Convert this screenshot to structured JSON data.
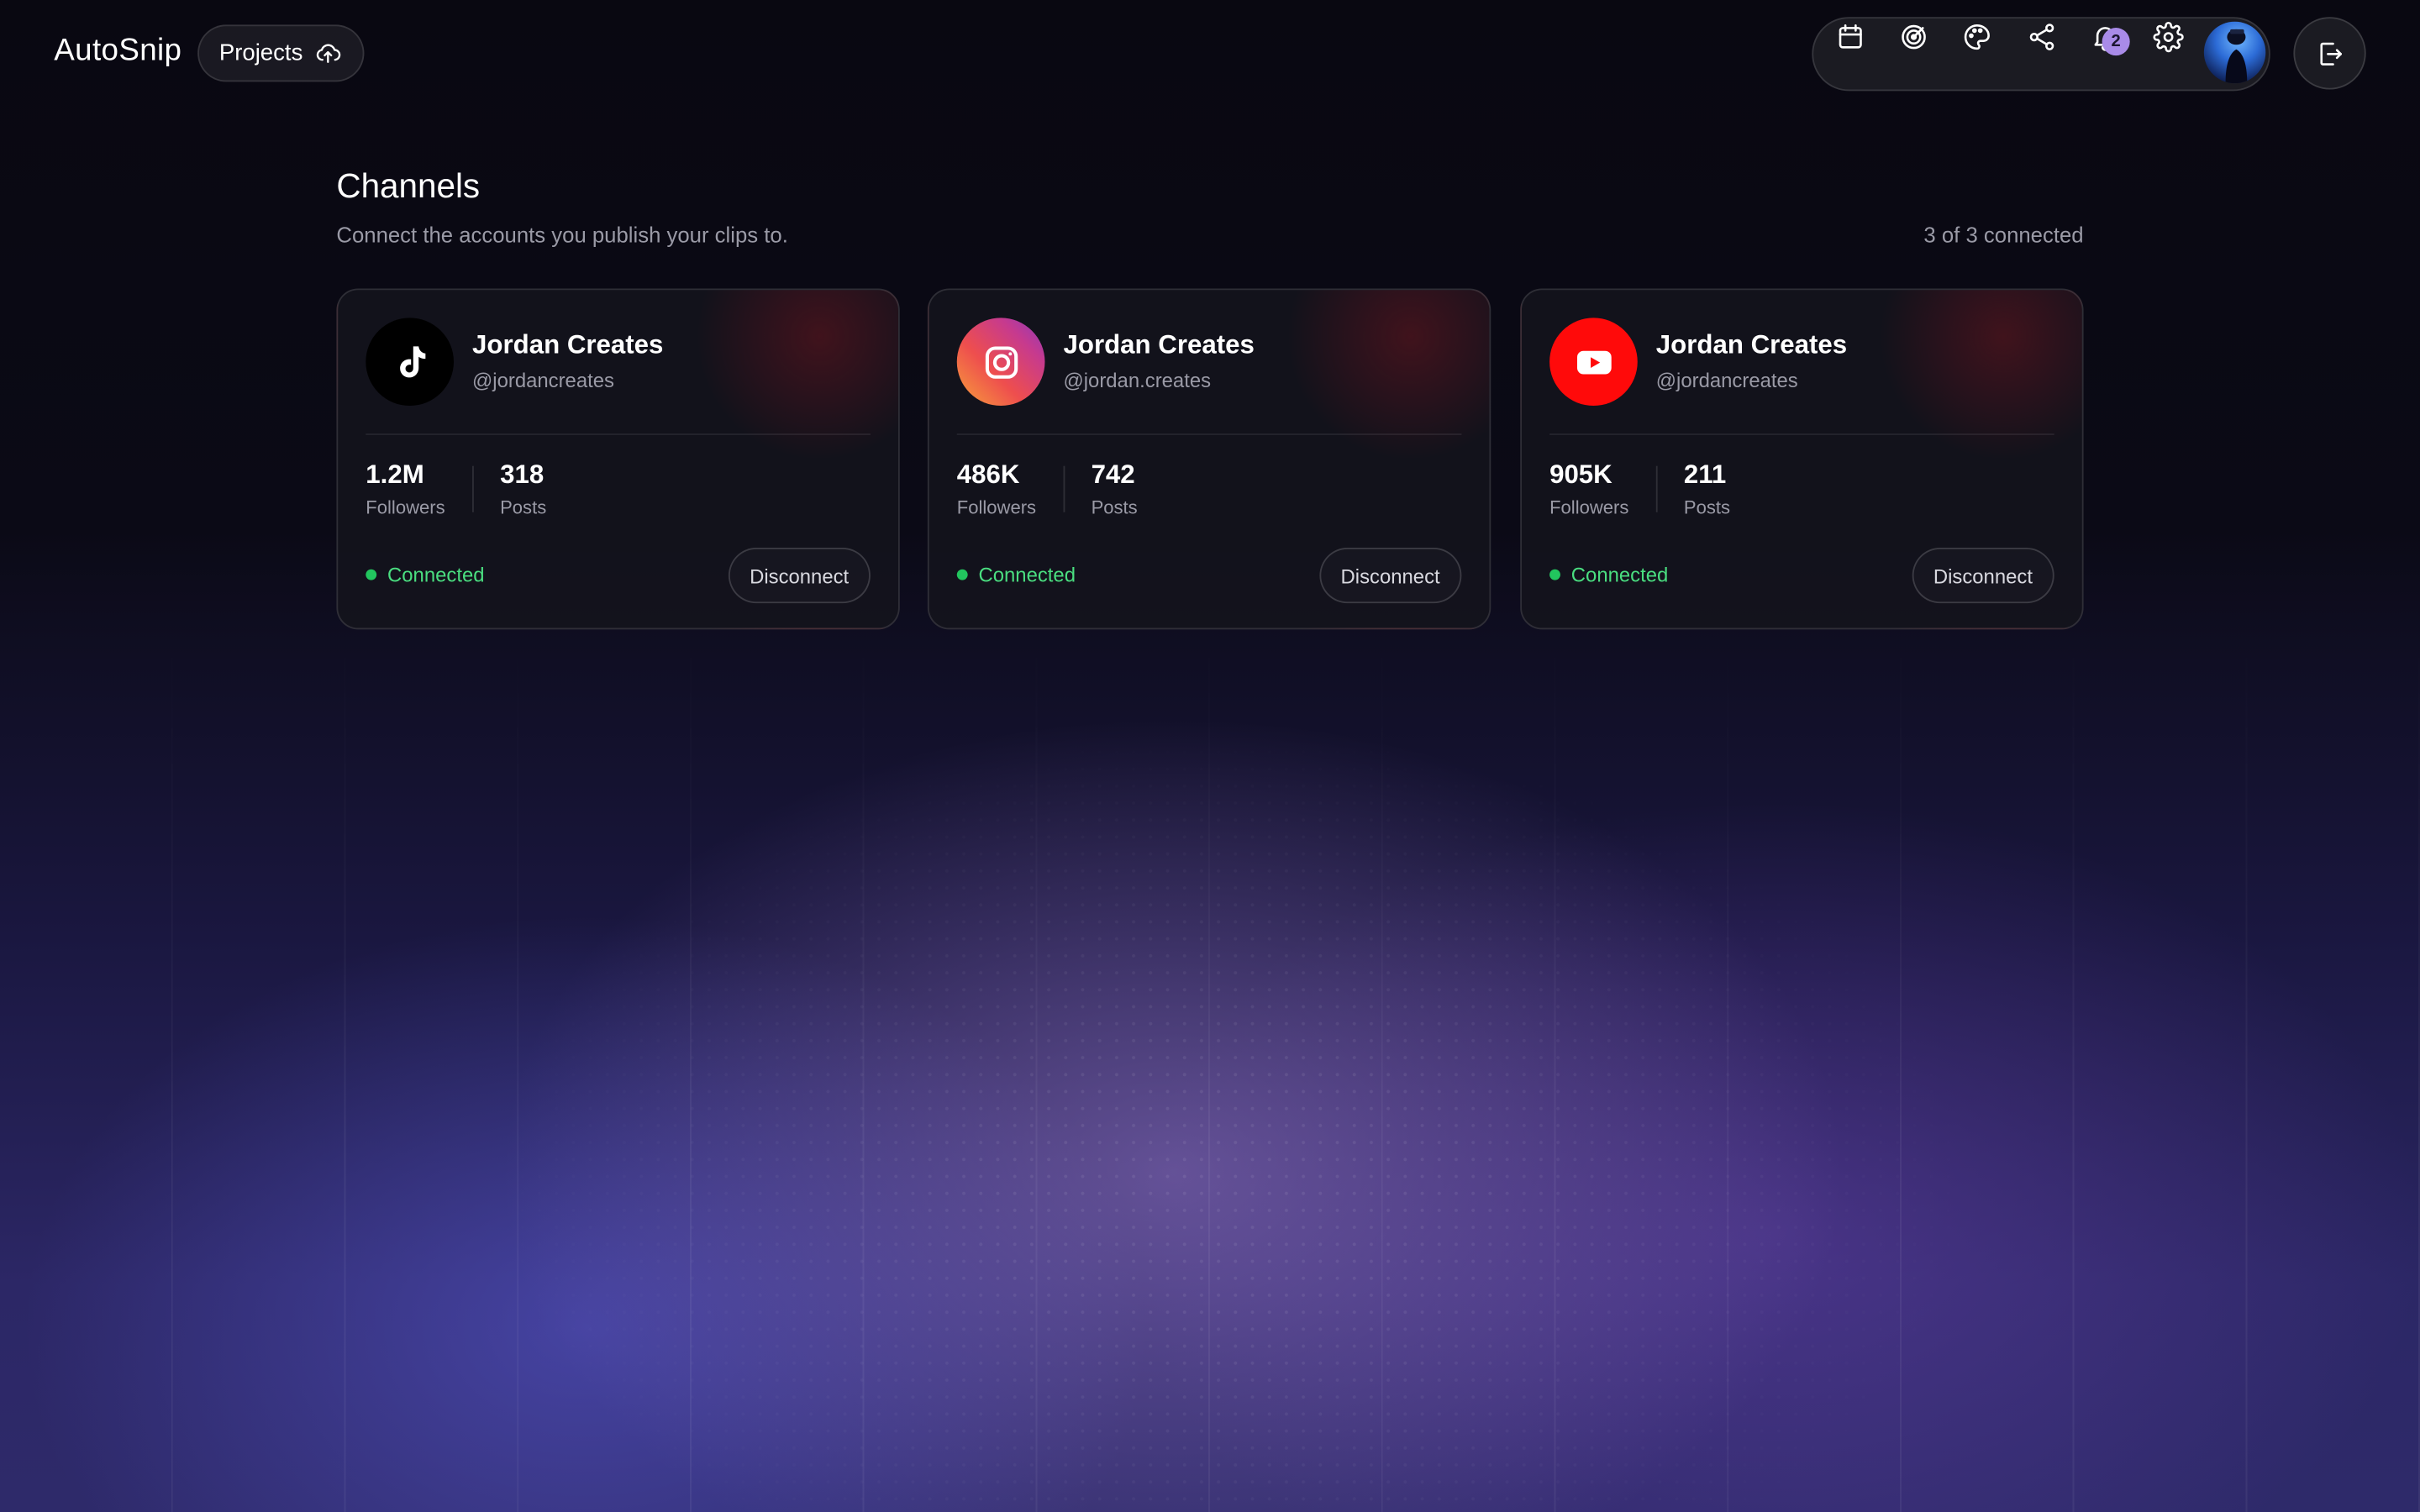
{
  "header": {
    "brand": "AutoSnip",
    "projects_label": "Projects",
    "toolbar_icons": [
      "calendar-icon",
      "radar-icon",
      "palette-icon",
      "share-icon",
      "bell-icon",
      "gear-icon"
    ],
    "notification_count": "2"
  },
  "page": {
    "title": "Channels",
    "subtitle": "Connect the accounts you publish your clips to.",
    "connected_count": "3 of 3 connected"
  },
  "channels": [
    {
      "platform_icon": "tiktok-icon",
      "name": "Jordan Creates",
      "handle": "@jordancreates",
      "followers": "1.2M",
      "followers_label": "Followers",
      "posts": "318",
      "posts_label": "Posts",
      "status": "Connected",
      "action": "Disconnect"
    },
    {
      "platform_icon": "instagram-icon",
      "name": "Jordan Creates",
      "handle": "@jordan.creates",
      "followers": "486K",
      "followers_label": "Followers",
      "posts": "742",
      "posts_label": "Posts",
      "status": "Connected",
      "action": "Disconnect"
    },
    {
      "platform_icon": "youtube-icon",
      "name": "Jordan Creates",
      "handle": "@jordancreates",
      "followers": "905K",
      "followers_label": "Followers",
      "posts": "211",
      "posts_label": "Posts",
      "status": "Connected",
      "action": "Disconnect"
    }
  ],
  "colors": {
    "status_connected": "#22c55e",
    "notification_badge": "#a98be8",
    "youtube_red": "#ff0a0a"
  }
}
